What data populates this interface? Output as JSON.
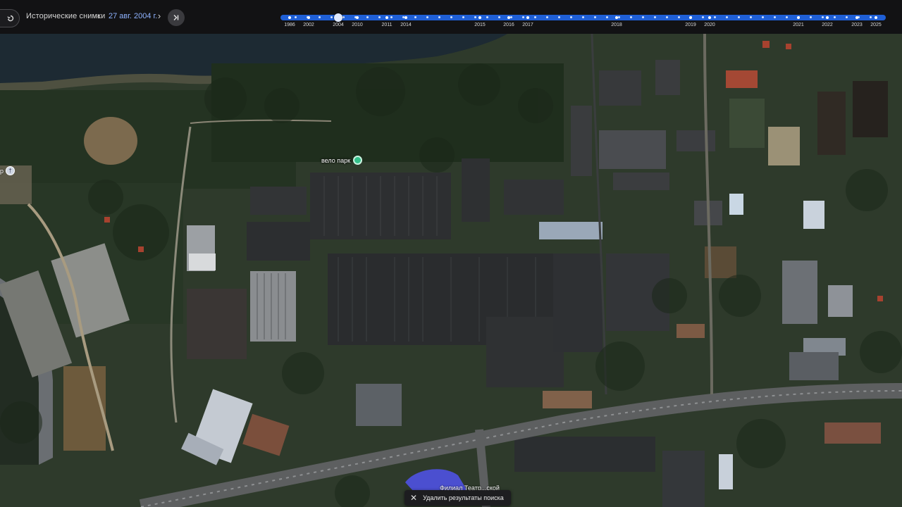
{
  "toolbar": {
    "historical_label": "Исторические снимки",
    "prev_icon": "chevron-left-icon",
    "next_icon": "chevron-right-icon",
    "current_date": "27 авг. 2004 г.",
    "latest_icon": "skip-to-latest-icon",
    "back_icon": "undo-icon"
  },
  "timeline": {
    "years": [
      "1986",
      "2002",
      "2004",
      "2010",
      "2011",
      "2014",
      "2015",
      "2016",
      "2017",
      "2018",
      "2019",
      "2020",
      "2021",
      "2022",
      "2023",
      "2025"
    ],
    "selected": "2004",
    "track_color": "#1f5fd6"
  },
  "map": {
    "poi_velopark": "вело парк",
    "poi_left_partial": "р",
    "bottom_place": "Филиал Театр...ской"
  },
  "search": {
    "clear_label": "Удалить результаты поиска"
  }
}
